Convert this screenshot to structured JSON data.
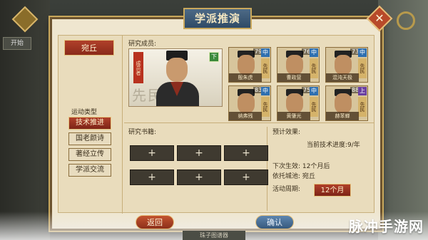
{
  "window": {
    "title": "学派推演",
    "close_label": "✕",
    "left_corner_label": "开始"
  },
  "location": "宛丘",
  "research_members": {
    "label": "研究成员:",
    "lead": {
      "tag": "成员者",
      "ghost_text": "先民",
      "grade": "下"
    },
    "members": [
      {
        "level": "79",
        "grade": "中",
        "tag": "先民",
        "name": "殷朱虎"
      },
      {
        "level": "76",
        "grade": "中",
        "tag": "先民",
        "name": "曹政营"
      },
      {
        "level": "73",
        "grade": "中",
        "tag": "先民",
        "name": "混沌天极"
      },
      {
        "level": "83",
        "grade": "中",
        "tag": "先民",
        "name": "纳弗残"
      },
      {
        "level": "75",
        "grade": "中",
        "tag": "先民",
        "name": "黄肇光"
      },
      {
        "level": "88",
        "grade": "上",
        "tag": "先民",
        "name": "赫苯蝉"
      }
    ]
  },
  "activity_types": {
    "label": "运动类型",
    "items": [
      {
        "label": "技术推进",
        "active": true
      },
      {
        "label": "国老颜诗",
        "active": false
      },
      {
        "label": "著经立传",
        "active": false
      },
      {
        "label": "学派交流",
        "active": false
      }
    ]
  },
  "research_books": {
    "label": "研究书籍:",
    "slot_glyph": "+"
  },
  "effects": {
    "expected_label": "预计效果:",
    "tech_progress": "当前技术进度:9/年",
    "next_effect": "下次生效:  12个月后",
    "host_city": "依托城池:  宛丘",
    "period_label": "活动周期:",
    "period_value": "12个月"
  },
  "buttons": {
    "back": "返回",
    "confirm": "确认",
    "bottom_mid": "珠子图谱器"
  },
  "watermark": "脉冲手游网"
}
